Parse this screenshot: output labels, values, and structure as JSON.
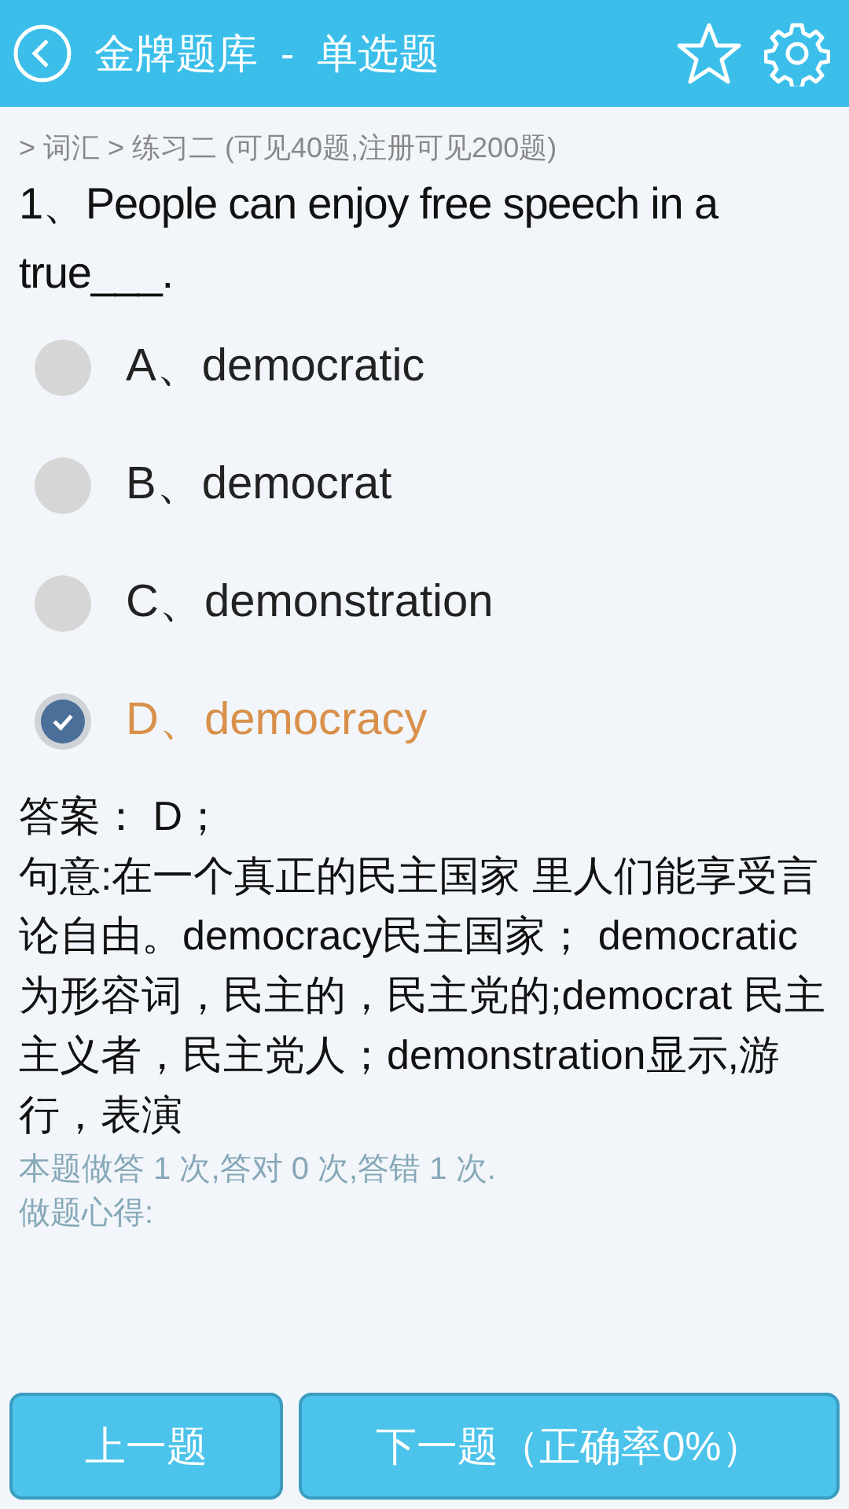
{
  "header": {
    "title": "金牌题库  -  单选题"
  },
  "breadcrumb": "> 词汇 > 练习二 (可见40题,注册可见200题)",
  "question": "1、People can enjoy free speech in a true___.",
  "options": [
    {
      "label": "A、democratic",
      "selected": false
    },
    {
      "label": "B、democrat",
      "selected": false
    },
    {
      "label": "C、demonstration",
      "selected": false
    },
    {
      "label": "D、democracy",
      "selected": true
    }
  ],
  "answer": "答案： D；",
  "explanation": "句意:在一个真正的民主国家 里人们能享受言论自由。democracy民主国家； democratic为形容词，民主的，民主党的;democrat 民主主义者，民主党人；demonstration显示,游行，表演",
  "stats": "本题做答 1 次,答对 0 次,答错 1 次.",
  "notes_label": "做题心得:",
  "buttons": [
    "上一题",
    "下一题（正确率0%）"
  ]
}
